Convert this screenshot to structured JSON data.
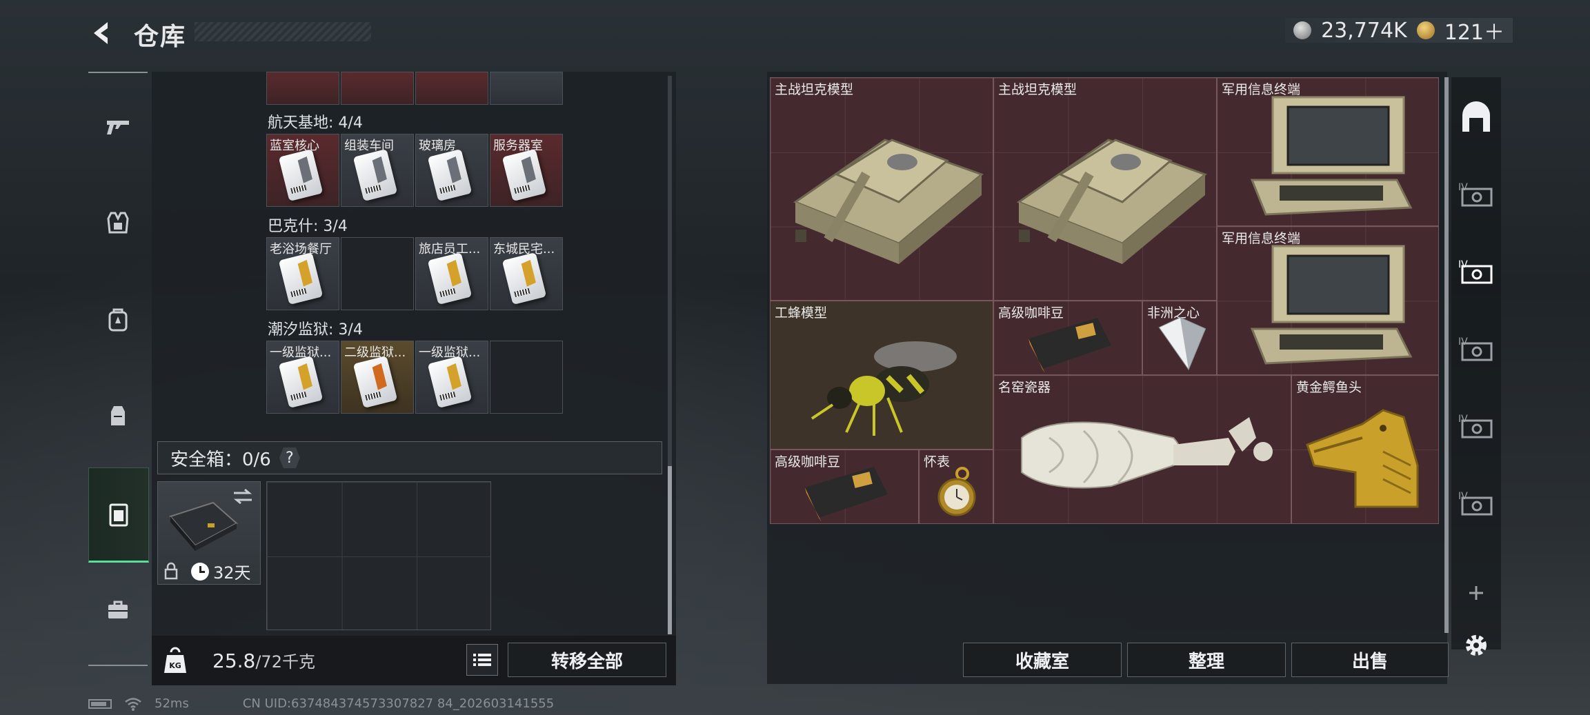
{
  "header": {
    "title": "仓库"
  },
  "currency": {
    "silver": "23,774K",
    "gold": "121＋"
  },
  "sidebar": {
    "items": [
      "gun-icon",
      "armor-vest-icon",
      "backpack-icon",
      "rig-icon",
      "safebox-icon",
      "briefcase-icon"
    ]
  },
  "keycards": {
    "groups": [
      {
        "title": "航天基地: 4/4",
        "cards": [
          {
            "label": "蓝室核心",
            "rarity": "red"
          },
          {
            "label": "组装车间",
            "rarity": "gray"
          },
          {
            "label": "玻璃房",
            "rarity": "gray"
          },
          {
            "label": "服务器室",
            "rarity": "red"
          }
        ]
      },
      {
        "title": "巴克什: 3/4",
        "cards": [
          {
            "label": "老浴场餐厅",
            "rarity": "gray"
          },
          {
            "label": "",
            "rarity": "empty"
          },
          {
            "label": "旅店员工...",
            "rarity": "gray"
          },
          {
            "label": "东城民宅...",
            "rarity": "gray"
          }
        ]
      },
      {
        "title": "潮汐监狱: 3/4",
        "cards": [
          {
            "label": "一级监狱...",
            "rarity": "gray"
          },
          {
            "label": "二级监狱...",
            "rarity": "gold"
          },
          {
            "label": "一级监狱...",
            "rarity": "gray"
          },
          {
            "label": "",
            "rarity": "empty"
          }
        ]
      }
    ]
  },
  "safebox": {
    "label": "安全箱：0/6",
    "help": "?",
    "days": "32天"
  },
  "weight": {
    "current": "25.8",
    "max": "/72千克"
  },
  "buttons": {
    "transfer_all": "转移全部",
    "collection": "收藏室",
    "sort": "整理",
    "sell": "出售"
  },
  "items": {
    "tank1": "主战坦克模型",
    "tank2": "主战坦克模型",
    "terminal1": "军用信息终端",
    "terminal2": "军用信息终端",
    "bee": "工蜂模型",
    "coffee1": "高级咖啡豆",
    "heart": "非洲之心",
    "vase": "名窑瓷器",
    "croc": "黄金鳄鱼头",
    "coffee2": "高级咖啡豆",
    "watch": "怀表"
  },
  "status": {
    "ping": "52ms",
    "uid": "CN UID:637484374573307827 84_202603141555"
  },
  "colors": {
    "accent_green": "#55e19a",
    "rare_red": "#5a2a2d",
    "legend_gold": "#5b4b2d"
  }
}
